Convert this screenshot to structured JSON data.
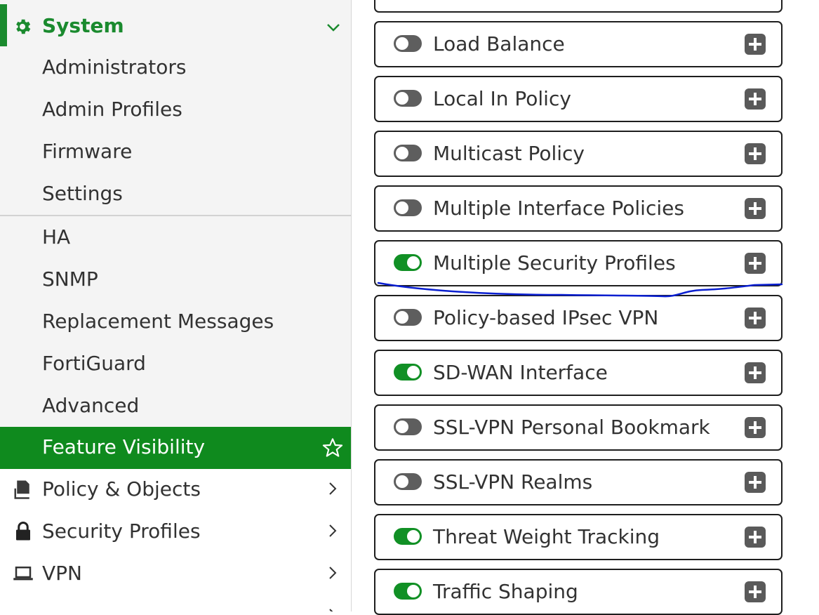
{
  "sidebar": {
    "section": {
      "title": "System",
      "icon": "gear-icon",
      "expand_icon": "chevron-down-icon"
    },
    "sub_items": [
      {
        "label": "Administrators"
      },
      {
        "label": "Admin Profiles"
      },
      {
        "label": "Firmware"
      },
      {
        "label": "Settings"
      },
      {
        "label": "HA"
      },
      {
        "label": "SNMP"
      },
      {
        "label": "Replacement Messages"
      },
      {
        "label": "FortiGuard"
      },
      {
        "label": "Advanced"
      },
      {
        "label": "Feature Visibility",
        "active": true,
        "icon": "star-icon"
      }
    ],
    "nav_items": [
      {
        "label": "Policy & Objects",
        "icon": "policy-icon"
      },
      {
        "label": "Security Profiles",
        "icon": "lock-icon"
      },
      {
        "label": "VPN",
        "icon": "laptop-icon"
      }
    ]
  },
  "features": [
    {
      "name": "Load Balance",
      "enabled": false
    },
    {
      "name": "Local In Policy",
      "enabled": false
    },
    {
      "name": "Multicast Policy",
      "enabled": false
    },
    {
      "name": "Multiple Interface Policies",
      "enabled": false
    },
    {
      "name": "Multiple Security Profiles",
      "enabled": true
    },
    {
      "name": "Policy-based IPsec VPN",
      "enabled": false
    },
    {
      "name": "SD-WAN Interface",
      "enabled": true
    },
    {
      "name": "SSL-VPN Personal Bookmark",
      "enabled": false
    },
    {
      "name": "SSL-VPN Realms",
      "enabled": false
    },
    {
      "name": "Threat Weight Tracking",
      "enabled": true
    },
    {
      "name": "Traffic Shaping",
      "enabled": true
    }
  ],
  "colors": {
    "accent": "#1a8a2e",
    "active_bg": "#0f8a1e",
    "toggle_on": "#119025",
    "toggle_off": "#5e5e5e",
    "annotation": "#0a1fd0"
  }
}
